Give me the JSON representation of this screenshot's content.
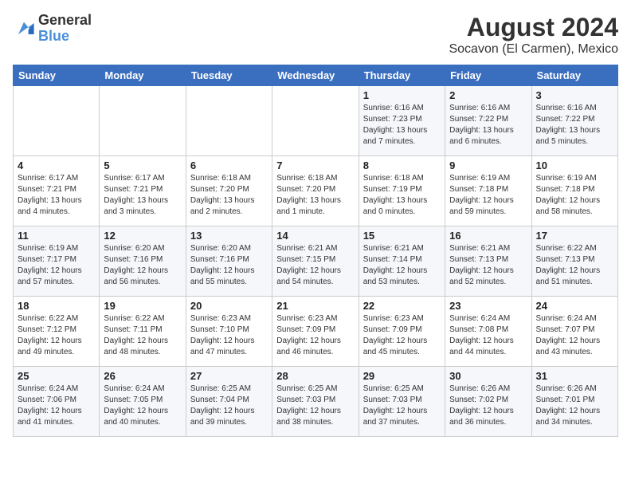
{
  "logo": {
    "line1": "General",
    "line2": "Blue"
  },
  "title": {
    "month_year": "August 2024",
    "location": "Socavon (El Carmen), Mexico"
  },
  "weekdays": [
    "Sunday",
    "Monday",
    "Tuesday",
    "Wednesday",
    "Thursday",
    "Friday",
    "Saturday"
  ],
  "weeks": [
    [
      {
        "day": "",
        "sunrise": "",
        "sunset": "",
        "daylight": ""
      },
      {
        "day": "",
        "sunrise": "",
        "sunset": "",
        "daylight": ""
      },
      {
        "day": "",
        "sunrise": "",
        "sunset": "",
        "daylight": ""
      },
      {
        "day": "",
        "sunrise": "",
        "sunset": "",
        "daylight": ""
      },
      {
        "day": "1",
        "sunrise": "Sunrise: 6:16 AM",
        "sunset": "Sunset: 7:23 PM",
        "daylight": "Daylight: 13 hours and 7 minutes."
      },
      {
        "day": "2",
        "sunrise": "Sunrise: 6:16 AM",
        "sunset": "Sunset: 7:22 PM",
        "daylight": "Daylight: 13 hours and 6 minutes."
      },
      {
        "day": "3",
        "sunrise": "Sunrise: 6:16 AM",
        "sunset": "Sunset: 7:22 PM",
        "daylight": "Daylight: 13 hours and 5 minutes."
      }
    ],
    [
      {
        "day": "4",
        "sunrise": "Sunrise: 6:17 AM",
        "sunset": "Sunset: 7:21 PM",
        "daylight": "Daylight: 13 hours and 4 minutes."
      },
      {
        "day": "5",
        "sunrise": "Sunrise: 6:17 AM",
        "sunset": "Sunset: 7:21 PM",
        "daylight": "Daylight: 13 hours and 3 minutes."
      },
      {
        "day": "6",
        "sunrise": "Sunrise: 6:18 AM",
        "sunset": "Sunset: 7:20 PM",
        "daylight": "Daylight: 13 hours and 2 minutes."
      },
      {
        "day": "7",
        "sunrise": "Sunrise: 6:18 AM",
        "sunset": "Sunset: 7:20 PM",
        "daylight": "Daylight: 13 hours and 1 minute."
      },
      {
        "day": "8",
        "sunrise": "Sunrise: 6:18 AM",
        "sunset": "Sunset: 7:19 PM",
        "daylight": "Daylight: 13 hours and 0 minutes."
      },
      {
        "day": "9",
        "sunrise": "Sunrise: 6:19 AM",
        "sunset": "Sunset: 7:18 PM",
        "daylight": "Daylight: 12 hours and 59 minutes."
      },
      {
        "day": "10",
        "sunrise": "Sunrise: 6:19 AM",
        "sunset": "Sunset: 7:18 PM",
        "daylight": "Daylight: 12 hours and 58 minutes."
      }
    ],
    [
      {
        "day": "11",
        "sunrise": "Sunrise: 6:19 AM",
        "sunset": "Sunset: 7:17 PM",
        "daylight": "Daylight: 12 hours and 57 minutes."
      },
      {
        "day": "12",
        "sunrise": "Sunrise: 6:20 AM",
        "sunset": "Sunset: 7:16 PM",
        "daylight": "Daylight: 12 hours and 56 minutes."
      },
      {
        "day": "13",
        "sunrise": "Sunrise: 6:20 AM",
        "sunset": "Sunset: 7:16 PM",
        "daylight": "Daylight: 12 hours and 55 minutes."
      },
      {
        "day": "14",
        "sunrise": "Sunrise: 6:21 AM",
        "sunset": "Sunset: 7:15 PM",
        "daylight": "Daylight: 12 hours and 54 minutes."
      },
      {
        "day": "15",
        "sunrise": "Sunrise: 6:21 AM",
        "sunset": "Sunset: 7:14 PM",
        "daylight": "Daylight: 12 hours and 53 minutes."
      },
      {
        "day": "16",
        "sunrise": "Sunrise: 6:21 AM",
        "sunset": "Sunset: 7:13 PM",
        "daylight": "Daylight: 12 hours and 52 minutes."
      },
      {
        "day": "17",
        "sunrise": "Sunrise: 6:22 AM",
        "sunset": "Sunset: 7:13 PM",
        "daylight": "Daylight: 12 hours and 51 minutes."
      }
    ],
    [
      {
        "day": "18",
        "sunrise": "Sunrise: 6:22 AM",
        "sunset": "Sunset: 7:12 PM",
        "daylight": "Daylight: 12 hours and 49 minutes."
      },
      {
        "day": "19",
        "sunrise": "Sunrise: 6:22 AM",
        "sunset": "Sunset: 7:11 PM",
        "daylight": "Daylight: 12 hours and 48 minutes."
      },
      {
        "day": "20",
        "sunrise": "Sunrise: 6:23 AM",
        "sunset": "Sunset: 7:10 PM",
        "daylight": "Daylight: 12 hours and 47 minutes."
      },
      {
        "day": "21",
        "sunrise": "Sunrise: 6:23 AM",
        "sunset": "Sunset: 7:09 PM",
        "daylight": "Daylight: 12 hours and 46 minutes."
      },
      {
        "day": "22",
        "sunrise": "Sunrise: 6:23 AM",
        "sunset": "Sunset: 7:09 PM",
        "daylight": "Daylight: 12 hours and 45 minutes."
      },
      {
        "day": "23",
        "sunrise": "Sunrise: 6:24 AM",
        "sunset": "Sunset: 7:08 PM",
        "daylight": "Daylight: 12 hours and 44 minutes."
      },
      {
        "day": "24",
        "sunrise": "Sunrise: 6:24 AM",
        "sunset": "Sunset: 7:07 PM",
        "daylight": "Daylight: 12 hours and 43 minutes."
      }
    ],
    [
      {
        "day": "25",
        "sunrise": "Sunrise: 6:24 AM",
        "sunset": "Sunset: 7:06 PM",
        "daylight": "Daylight: 12 hours and 41 minutes."
      },
      {
        "day": "26",
        "sunrise": "Sunrise: 6:24 AM",
        "sunset": "Sunset: 7:05 PM",
        "daylight": "Daylight: 12 hours and 40 minutes."
      },
      {
        "day": "27",
        "sunrise": "Sunrise: 6:25 AM",
        "sunset": "Sunset: 7:04 PM",
        "daylight": "Daylight: 12 hours and 39 minutes."
      },
      {
        "day": "28",
        "sunrise": "Sunrise: 6:25 AM",
        "sunset": "Sunset: 7:03 PM",
        "daylight": "Daylight: 12 hours and 38 minutes."
      },
      {
        "day": "29",
        "sunrise": "Sunrise: 6:25 AM",
        "sunset": "Sunset: 7:03 PM",
        "daylight": "Daylight: 12 hours and 37 minutes."
      },
      {
        "day": "30",
        "sunrise": "Sunrise: 6:26 AM",
        "sunset": "Sunset: 7:02 PM",
        "daylight": "Daylight: 12 hours and 36 minutes."
      },
      {
        "day": "31",
        "sunrise": "Sunrise: 6:26 AM",
        "sunset": "Sunset: 7:01 PM",
        "daylight": "Daylight: 12 hours and 34 minutes."
      }
    ]
  ]
}
